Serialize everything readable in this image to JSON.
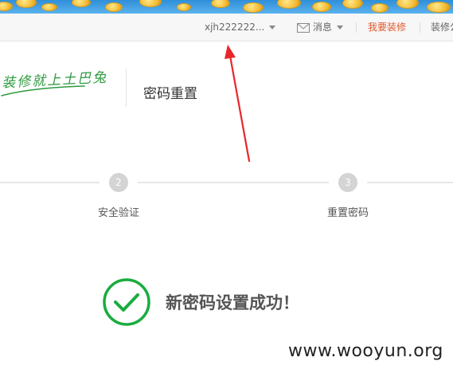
{
  "toolbar": {
    "username": "xjh222222...",
    "messages_label": "消息",
    "decorate_link": "我要装修",
    "more_link": "装修公"
  },
  "header": {
    "logo_text": "装修就上土巴兔",
    "page_title": "密码重置"
  },
  "steps": [
    {
      "number": "2",
      "label": "安全验证"
    },
    {
      "number": "3",
      "label": "重置密码"
    }
  ],
  "result": {
    "message": "新密码设置成功！"
  },
  "watermark": "www.wooyun.org",
  "colors": {
    "accent": "#e2572b",
    "success": "#1aac40",
    "annotation": "#e8262a",
    "brand_green": "#2e9a3f"
  }
}
